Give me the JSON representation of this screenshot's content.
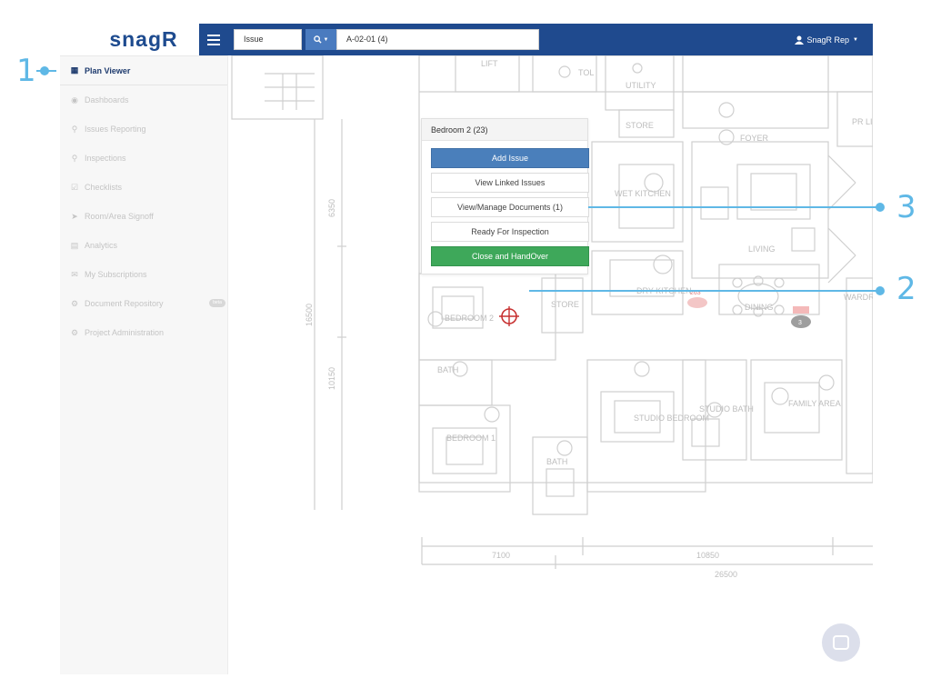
{
  "app": {
    "logo": "snagR"
  },
  "sidebar": {
    "items": [
      {
        "label": "Plan Viewer",
        "icon": "image-icon",
        "active": true
      },
      {
        "label": "Dashboards",
        "icon": "dashboard-icon"
      },
      {
        "label": "Issues Reporting",
        "icon": "map-marker-icon"
      },
      {
        "label": "Inspections",
        "icon": "search-icon"
      },
      {
        "label": "Checklists",
        "icon": "checkbox-icon"
      },
      {
        "label": "Room/Area Signoff",
        "icon": "send-icon"
      },
      {
        "label": "Analytics",
        "icon": "bar-chart-icon"
      },
      {
        "label": "My Subscriptions",
        "icon": "envelope-icon"
      },
      {
        "label": "Document Repository",
        "icon": "repository-icon",
        "badge": "beta"
      },
      {
        "label": "Project Administration",
        "icon": "gears-icon"
      }
    ]
  },
  "topbar": {
    "search_type": "Issue",
    "search_value": "A-02-01 (4)",
    "user": "SnagR Rep"
  },
  "plan": {
    "labels": [
      "LIFT",
      "TOL",
      "UTILITY",
      "STORE",
      "FOYER",
      "WET KITCHEN",
      "LIVING",
      "DRY KITCHEN",
      "STORE",
      "DINING",
      "BEDROOM 2",
      "BATH",
      "BEDROOM 1",
      "BATH",
      "STUDIO BEDROOM",
      "STUDIO BATH",
      "FAMILY AREA",
      "WARDR",
      "PR LIFT"
    ],
    "dimensions": [
      "6350",
      "16500",
      "10150",
      "7100",
      "10850",
      "26500"
    ],
    "markers": [
      "263",
      "3"
    ]
  },
  "popup": {
    "title": "Bedroom 2 (23)",
    "buttons": [
      "Add Issue",
      "View Linked Issues",
      "View/Manage Documents (1)",
      "Ready For Inspection",
      "Close and HandOver"
    ]
  },
  "callouts": [
    "1",
    "2",
    "3"
  ]
}
